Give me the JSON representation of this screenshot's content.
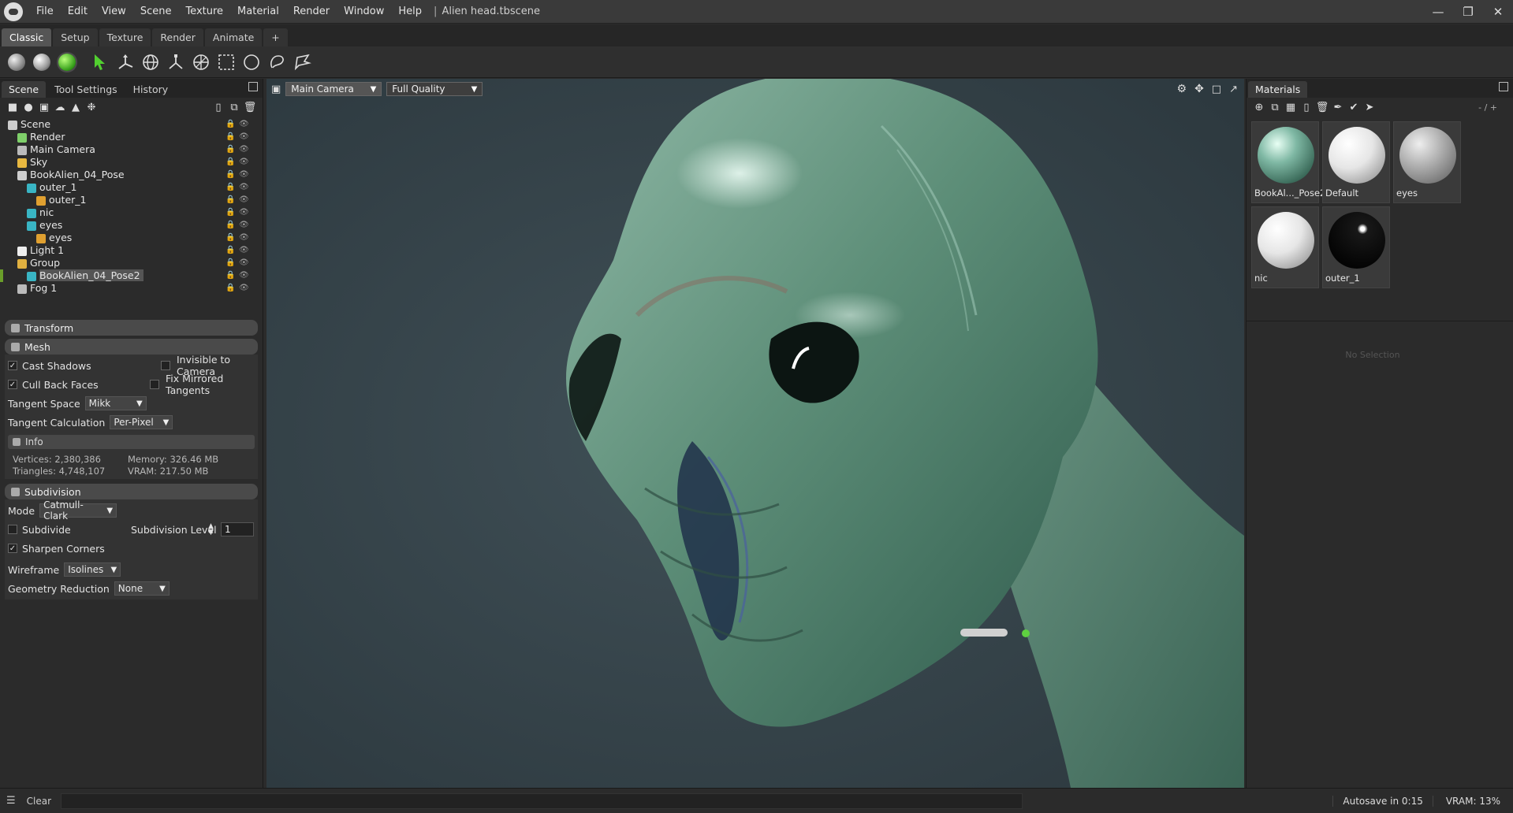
{
  "app": {
    "menu": [
      "File",
      "Edit",
      "View",
      "Scene",
      "Texture",
      "Material",
      "Render",
      "Window",
      "Help"
    ],
    "document_title": "Alien head.tbscene",
    "separator": "|"
  },
  "workspace_tabs": [
    "Classic",
    "Setup",
    "Texture",
    "Render",
    "Animate",
    "+"
  ],
  "left_panel": {
    "tabs": [
      "Scene",
      "Tool Settings",
      "History"
    ],
    "tree": [
      {
        "label": "Scene",
        "depth": 0,
        "icon": "scene-icon",
        "color": "#cccccc"
      },
      {
        "label": "Render",
        "depth": 1,
        "icon": "render-icon",
        "color": "#7fd06a"
      },
      {
        "label": "Main Camera",
        "depth": 1,
        "icon": "camera-icon",
        "color": "#bbbbbb"
      },
      {
        "label": "Sky",
        "depth": 1,
        "icon": "sky-icon",
        "color": "#e8b840"
      },
      {
        "label": "BookAlien_04_Pose",
        "depth": 1,
        "icon": "mesh-icon",
        "color": "#cfcfcf"
      },
      {
        "label": "outer_1",
        "depth": 2,
        "icon": "mesh-icon",
        "color": "#39b5c4"
      },
      {
        "label": "outer_1",
        "depth": 3,
        "icon": "material-icon",
        "color": "#e0a030"
      },
      {
        "label": "nic",
        "depth": 2,
        "icon": "mesh-icon",
        "color": "#39b5c4"
      },
      {
        "label": "eyes",
        "depth": 2,
        "icon": "mesh-icon",
        "color": "#39b5c4"
      },
      {
        "label": "eyes",
        "depth": 3,
        "icon": "material-icon",
        "color": "#e0a030"
      },
      {
        "label": "Light 1",
        "depth": 1,
        "icon": "light-icon",
        "color": "#eeeeee"
      },
      {
        "label": "Group",
        "depth": 1,
        "icon": "folder-icon",
        "color": "#e0b040"
      },
      {
        "label": "BookAlien_04_Pose2",
        "depth": 2,
        "icon": "mesh-icon",
        "color": "#39b5c4",
        "selected": true
      },
      {
        "label": "Fog 1",
        "depth": 1,
        "icon": "fog-icon",
        "color": "#bbbbbb"
      }
    ],
    "transform_title": "Transform",
    "mesh": {
      "title": "Mesh",
      "cast_shadows": "Cast Shadows",
      "cast_shadows_checked": true,
      "invisible_to_camera": "Invisible to Camera",
      "invisible_to_camera_checked": false,
      "cull_back_faces": "Cull Back Faces",
      "cull_back_faces_checked": true,
      "fix_mirrored_tangents": "Fix Mirrored Tangents",
      "fix_mirrored_tangents_checked": false,
      "tangent_space_label": "Tangent Space",
      "tangent_space_value": "Mikk",
      "tangent_calc_label": "Tangent Calculation",
      "tangent_calc_value": "Per-Pixel",
      "info_title": "Info",
      "vertices": "Vertices:  2,380,386",
      "triangles": "Triangles:  4,748,107",
      "memory": "Memory:  326.46 MB",
      "vram": "VRAM:  217.50 MB"
    },
    "subdivision": {
      "title": "Subdivision",
      "mode_label": "Mode",
      "mode_value": "Catmull-Clark",
      "subdivide": "Subdivide",
      "subdivide_checked": false,
      "level_label": "Subdivision Level",
      "level_value": "1",
      "sharpen_corners": "Sharpen Corners",
      "sharpen_checked": true,
      "wireframe_label": "Wireframe",
      "wireframe_value": "Isolines",
      "geo_reduction_label": "Geometry Reduction",
      "geo_reduction_value": "None"
    }
  },
  "viewport": {
    "camera": "Main Camera",
    "quality": "Full Quality"
  },
  "right_panel": {
    "title": "Materials",
    "counter": "- / +",
    "materials": [
      {
        "name": "BookAl..._Pose2",
        "style": "alien"
      },
      {
        "name": "Default",
        "style": "white"
      },
      {
        "name": "eyes",
        "style": "grey"
      },
      {
        "name": "nic",
        "style": "white"
      },
      {
        "name": "outer_1",
        "style": "black"
      }
    ],
    "empty_text": "No Selection"
  },
  "status": {
    "clear": "Clear",
    "autosave": "Autosave in 0:15",
    "vram": "VRAM: 13%"
  }
}
